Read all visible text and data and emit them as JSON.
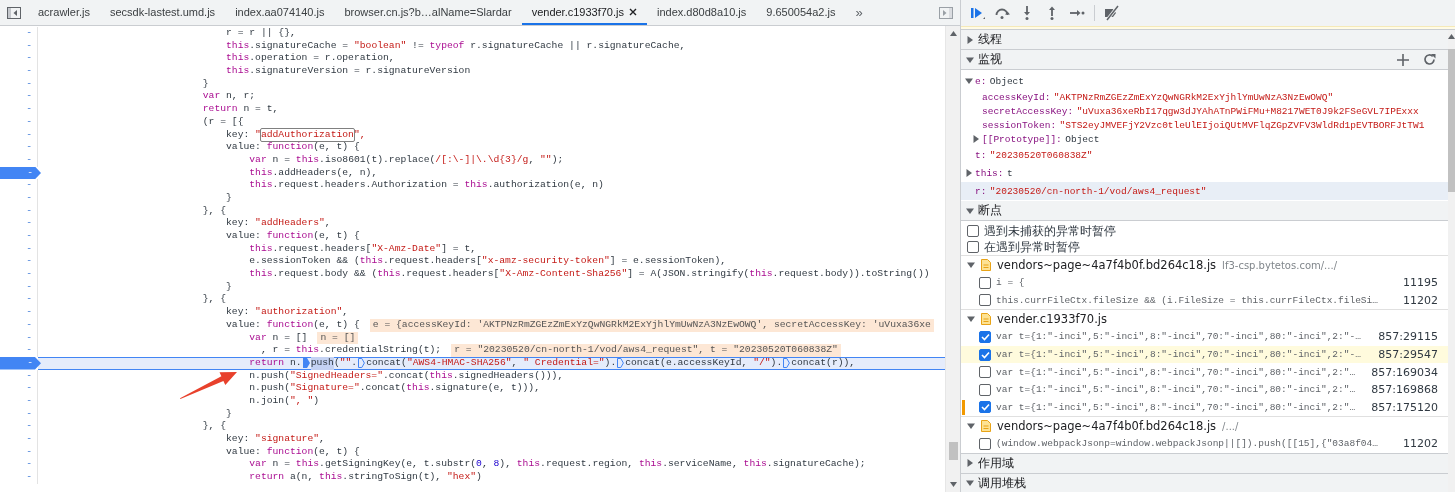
{
  "editor_tabs": [
    {
      "label": "acrawler.js",
      "selected": false
    },
    {
      "label": "secsdk-lastest.umd.js",
      "selected": false
    },
    {
      "label": "index.aa074140.js",
      "selected": false
    },
    {
      "label": "browser.cn.js?b…alName=Slardar",
      "selected": false
    },
    {
      "label": "vender.c1933f70.js",
      "selected": true
    },
    {
      "label": "index.d80d8a10.js",
      "selected": false
    },
    {
      "label": "9.650054a2.js",
      "selected": false
    }
  ],
  "more_tabs": "»",
  "code": {
    "lines": [
      {
        "line_number": "-",
        "code": "                                r = r || {},",
        "breakpoint": false,
        "paused": false
      },
      {
        "line_number": "-",
        "code": "                                this.signatureCache = \"boolean\" != typeof r.signatureCache || r.signatureCache,",
        "breakpoint": false,
        "paused": false
      },
      {
        "line_number": "-",
        "code": "                                this.operation = r.operation,",
        "breakpoint": false,
        "paused": false
      },
      {
        "line_number": "-",
        "code": "                                this.signatureVersion = r.signatureVersion",
        "breakpoint": false,
        "paused": false
      },
      {
        "line_number": "-",
        "code": "                            }",
        "breakpoint": false,
        "paused": false
      },
      {
        "line_number": "-",
        "code": "                            var n, r;",
        "breakpoint": false,
        "paused": false
      },
      {
        "line_number": "-",
        "code": "                            return n = t,",
        "breakpoint": false,
        "paused": false
      },
      {
        "line_number": "-",
        "code": "                            (r = [{",
        "breakpoint": false,
        "paused": false
      },
      {
        "line_number": "-",
        "parts": [
          {
            "kind": "text",
            "text": "                                key: \""
          },
          {
            "kind": "match",
            "text": "addAuthorization"
          },
          {
            "kind": "text",
            "text": "\","
          }
        ],
        "breakpoint": false,
        "paused": false
      },
      {
        "line_number": "-",
        "code": "                                value: function(e, t) {",
        "breakpoint": false,
        "paused": false
      },
      {
        "line_number": "-",
        "code": "                                    var n = this.iso8601(t).replace(/[:\\-]|\\.\\d{3}/g, \"\");",
        "breakpoint": false,
        "paused": false
      },
      {
        "line_number": "-",
        "code": "                                    this.addHeaders(e, n),",
        "breakpoint": true,
        "paused": false
      },
      {
        "line_number": "-",
        "code": "                                    this.request.headers.Authorization = this.authorization(e, n)",
        "breakpoint": false,
        "paused": false
      },
      {
        "line_number": "-",
        "code": "                                }",
        "breakpoint": false,
        "paused": false
      },
      {
        "line_number": "-",
        "code": "                            }, {",
        "breakpoint": false,
        "paused": false
      },
      {
        "line_number": "-",
        "code": "                                key: \"addHeaders\",",
        "breakpoint": false,
        "paused": false
      },
      {
        "line_number": "-",
        "code": "                                value: function(e, t) {",
        "breakpoint": false,
        "paused": false
      },
      {
        "line_number": "-",
        "code": "                                    this.request.headers[\"X-Amz-Date\"] = t,",
        "breakpoint": false,
        "paused": false
      },
      {
        "line_number": "-",
        "code": "                                    e.sessionToken && (this.request.headers[\"x-amz-security-token\"] = e.sessionToken),",
        "breakpoint": false,
        "paused": false
      },
      {
        "line_number": "-",
        "code": "                                    this.request.body && (this.request.headers[\"X-Amz-Content-Sha256\"] = A(JSON.stringify(this.request.body)).toString())",
        "breakpoint": false,
        "paused": false
      },
      {
        "line_number": "-",
        "code": "                                }",
        "breakpoint": false,
        "paused": false
      },
      {
        "line_number": "-",
        "code": "                            }, {",
        "breakpoint": false,
        "paused": false
      },
      {
        "line_number": "-",
        "code": "                                key: \"authorization\",",
        "breakpoint": false,
        "paused": false
      },
      {
        "line_number": "-",
        "code": "                                value: function(e, t) {",
        "inline_value": "e = {accessKeyId: 'AKTPNzRmZGEzZmExYzQwNGRkM2ExYjhlYmUwNzA3NzEwOWQ', secretAccessKey: 'uVuxa36xe",
        "breakpoint": false,
        "paused": false
      },
      {
        "line_number": "-",
        "code": "                                    var n = []",
        "inline_value": "n = []",
        "breakpoint": false,
        "paused": false
      },
      {
        "line_number": "-",
        "code": "                                      , r = this.credentialString(t);",
        "inline_value": "r = \"20230520/cn-north-1/vod/aws4_request\", t = \"20230520T060838Z\"",
        "breakpoint": false,
        "paused": false
      },
      {
        "line_number": "-",
        "parts": [
          {
            "kind": "text",
            "text": "                                    return n."
          },
          {
            "kind": "marker",
            "active": true
          },
          {
            "kind": "current",
            "text": "push"
          },
          {
            "kind": "text",
            "text": "(\"\"."
          },
          {
            "kind": "marker",
            "active": false
          },
          {
            "kind": "text",
            "text": "concat(\"AWS4-HMAC-SHA256\", \" Credential=\")."
          },
          {
            "kind": "marker",
            "active": false
          },
          {
            "kind": "text",
            "text": "concat(e.accessKeyId, \"/\")."
          },
          {
            "kind": "marker",
            "active": false
          },
          {
            "kind": "text",
            "text": "concat(r)),"
          }
        ],
        "breakpoint": true,
        "paused": true
      },
      {
        "line_number": "-",
        "code": "                                    n.push(\"SignedHeaders=\".concat(this.signedHeaders())),",
        "breakpoint": false,
        "paused": false
      },
      {
        "line_number": "-",
        "code": "                                    n.push(\"Signature=\".concat(this.signature(e, t))),",
        "breakpoint": false,
        "paused": false
      },
      {
        "line_number": "-",
        "code": "                                    n.join(\", \")",
        "breakpoint": false,
        "paused": false
      },
      {
        "line_number": "-",
        "code": "                                }",
        "breakpoint": false,
        "paused": false
      },
      {
        "line_number": "-",
        "code": "                            }, {",
        "breakpoint": false,
        "paused": false
      },
      {
        "line_number": "-",
        "code": "                                key: \"signature\",",
        "breakpoint": false,
        "paused": false
      },
      {
        "line_number": "-",
        "code": "                                value: function(e, t) {",
        "breakpoint": false,
        "paused": false
      },
      {
        "line_number": "-",
        "code": "                                    var n = this.getSigningKey(e, t.substr(0, 8), this.request.region, this.serviceName, this.signatureCache);",
        "breakpoint": false,
        "paused": false
      },
      {
        "line_number": "-",
        "code": "                                    return a(n, this.stringToSign(t), \"hex\")",
        "breakpoint": false,
        "paused": false
      }
    ]
  },
  "debugger": {
    "sections": [
      {
        "kind": "header-only",
        "title": "线程",
        "expanded": false
      },
      {
        "kind": "watch",
        "title": "监视",
        "expanded": true,
        "items": [
          {
            "name": "e:",
            "value": "Object",
            "kind": "object",
            "expanded": true,
            "selected": false,
            "children": [
              {
                "name": "accessKeyId:",
                "value": "\"AKTPNzRmZGEzZmExYzQwNGRkM2ExYjhlYmUwNzA3NzEwOWQ\"",
                "kind": "string"
              },
              {
                "name": "secretAccessKey:",
                "value": "\"uVuxa36xeRbI17qgw3dJYAhATnPWiFMu+M8217WET0J9k2FSeGVL7IPExxx",
                "kind": "string"
              },
              {
                "name": "sessionToken:",
                "value": "\"STS2eyJMVEFjY2Vzc0tleUlEIjoiQUtMVFlqZGpZVFV3WldRd1pEVTBORFJtTW1",
                "kind": "string"
              },
              {
                "name": "[[Prototype]]:",
                "value": "Object",
                "kind": "object",
                "expanded": false
              }
            ]
          },
          {
            "name": "t:",
            "value": "\"20230520T060838Z\"",
            "kind": "string",
            "selected": false
          },
          {
            "name": "this:",
            "value": "t",
            "kind": "object",
            "expanded": false,
            "selected": false
          },
          {
            "name": "r:",
            "value": "\"20230520/cn-north-1/vod/aws4_request\"",
            "kind": "string",
            "selected": true
          }
        ]
      },
      {
        "kind": "breakpoints",
        "title": "断点",
        "expanded": true,
        "pause_options": [
          {
            "label": "遇到未捕获的异常时暂停",
            "checked": false
          },
          {
            "label": "在遇到异常时暂停",
            "checked": false
          }
        ],
        "files": [
          {
            "name": "vendors~page~4a7f4b0f.bd264c18.js",
            "url": "lf3-csp.bytetos.com/.../",
            "expanded": true,
            "breakpoints": [
              {
                "code": "i = {",
                "line": "11195",
                "checked": false,
                "hit": false,
                "conditional": false
              },
              {
                "code": "this.currFileCtx.fileSize && (i.FileSize = this.currFileCtx.fileSi…",
                "line": "11202",
                "checked": false,
                "hit": false,
                "conditional": false
              }
            ]
          },
          {
            "name": "vender.c1933f70.js",
            "expanded": true,
            "breakpoints": [
              {
                "code": "var t={1:\"-inci\",5:\"-inci\",8:\"-inci\",70:\"-inci\",80:\"-inci\",2:\"-…",
                "line": "857:29115",
                "checked": true,
                "hit": false,
                "conditional": false
              },
              {
                "code": "var t={1:\"-inci\",5:\"-inci\",8:\"-inci\",70:\"-inci\",80:\"-inci\",2:\"-…",
                "line": "857:29547",
                "checked": true,
                "hit": true,
                "conditional": false
              },
              {
                "code": "var t={1:\"-inci\",5:\"-inci\",8:\"-inci\",70:\"-inci\",80:\"-inci\",2:\"…",
                "line": "857:169034",
                "checked": false,
                "hit": false,
                "conditional": false
              },
              {
                "code": "var t={1:\"-inci\",5:\"-inci\",8:\"-inci\",70:\"-inci\",80:\"-inci\",2:\"…",
                "line": "857:169868",
                "checked": false,
                "hit": false,
                "conditional": false
              },
              {
                "code": "var t={1:\"-inci\",5:\"-inci\",8:\"-inci\",70:\"-inci\",80:\"-inci\",2:\"…",
                "line": "857:175120",
                "checked": true,
                "hit": false,
                "conditional": true
              }
            ]
          },
          {
            "name": "vendors~page~4a7f4b0f.bd264c18.js",
            "url": "/.../",
            "expanded": true,
            "breakpoints": [
              {
                "code": "(window.webpackJsonp=window.webpackJsonp||[]).push([[15],{\"03a8f04…",
                "line": "11202",
                "checked": false,
                "hit": false,
                "conditional": false
              }
            ]
          }
        ]
      },
      {
        "kind": "header-only",
        "title": "作用域",
        "expanded": false
      },
      {
        "kind": "header-only",
        "title": "调用堆栈",
        "expanded": true
      }
    ]
  }
}
